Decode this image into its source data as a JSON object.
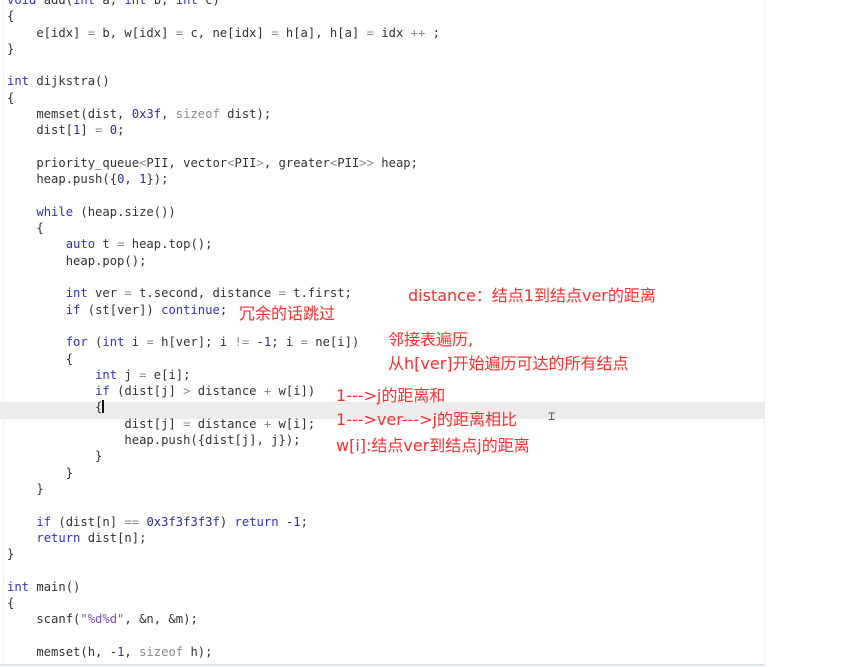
{
  "editor": {
    "language": "C++",
    "code_lines": [
      "void add(int a, int b, int c)",
      "{",
      "    e[idx] = b, w[idx] = c, ne[idx] = h[a], h[a] = idx ++ ;",
      "}",
      "",
      "int dijkstra()",
      "{",
      "    memset(dist, 0x3f, sizeof dist);",
      "    dist[1] = 0;",
      "",
      "    priority_queue<PII, vector<PII>, greater<PII>> heap;",
      "    heap.push({0, 1});",
      "",
      "    while (heap.size())",
      "    {",
      "        auto t = heap.top();",
      "        heap.pop();",
      "",
      "        int ver = t.second, distance = t.first;",
      "        if (st[ver]) continue;",
      "",
      "        for (int i = h[ver]; i != -1; i = ne[i])",
      "        {",
      "            int j = e[i];",
      "            if (dist[j] > distance + w[i])",
      "            {",
      "                dist[j] = distance + w[i];",
      "                heap.push({dist[j], j});",
      "            }",
      "        }",
      "    }",
      "",
      "    if (dist[n] == 0x3f3f3f3f) return -1;",
      "    return dist[n];",
      "}",
      "",
      "int main()",
      "{",
      "    scanf(\"%d%d\", &n, &m);",
      "",
      "    memset(h, -1, sizeof h);"
    ],
    "current_line_index": 25
  },
  "annotations": {
    "skip_redundant": "冗余的话跳过",
    "distance_meaning": "distance：结点1到结点ver的距离",
    "adjacency_line1": "邻接表遍历,",
    "adjacency_line2": "从h[ver]开始遍历可达的所有结点",
    "compare_line1": "1--->j的距离和",
    "compare_line2": "1--->ver--->j的距离相比",
    "weight_meaning": "w[i]:结点ver到结点j的距离"
  },
  "colors": {
    "annotation": "#ff2b2b",
    "keyword": "#3030c8",
    "text": "#333333",
    "current_line": "#ececec"
  }
}
